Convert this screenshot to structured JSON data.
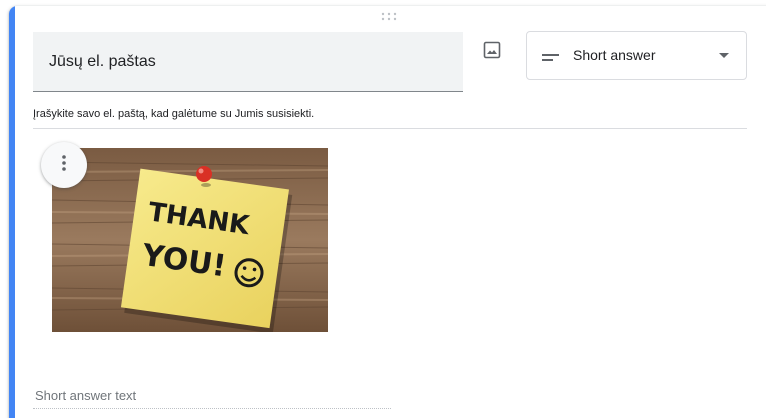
{
  "question": {
    "title": "Jūsų el. paštas",
    "description": "Įrašykite savo el. paštą, kad galėtume su Jumis susisiekti.",
    "type_label": "Short answer",
    "answer_placeholder": "Short answer text"
  },
  "image": {
    "note_text_line1": "THANK",
    "note_text_line2": "YOU!"
  },
  "icons": {
    "drag": "drag-handle-icon",
    "add_image": "image-icon",
    "short_answer": "short-answer-icon",
    "dropdown": "dropdown-arrow-icon",
    "more": "more-vert-icon"
  },
  "colors": {
    "accent": "#4285f4",
    "title_field_bg": "#f1f3f4",
    "note_yellow": "#f3e27a",
    "pin_red": "#d93025"
  }
}
